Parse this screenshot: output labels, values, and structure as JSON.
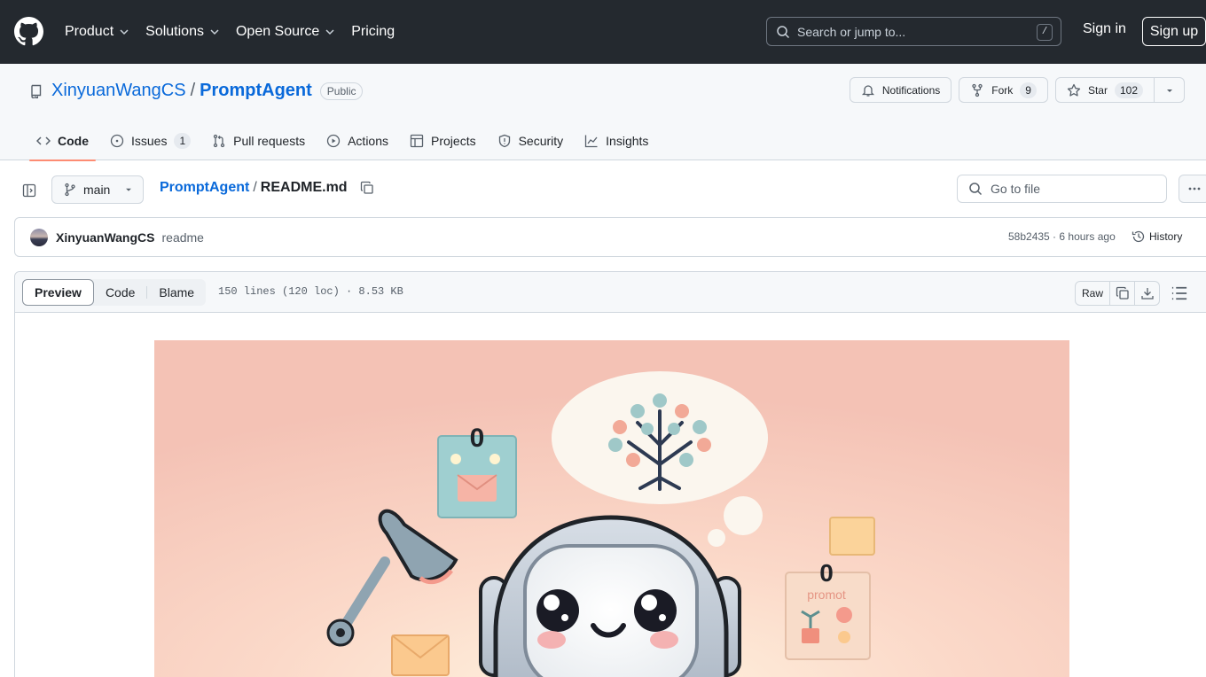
{
  "header": {
    "nav": [
      {
        "label": "Product",
        "dropdown": true
      },
      {
        "label": "Solutions",
        "dropdown": true
      },
      {
        "label": "Open Source",
        "dropdown": true
      },
      {
        "label": "Pricing",
        "dropdown": false
      }
    ],
    "search_placeholder": "Search or jump to...",
    "search_shortcut": "/",
    "sign_in": "Sign in",
    "sign_up": "Sign up"
  },
  "repo": {
    "owner": "XinyuanWangCS",
    "separator": "/",
    "name": "PromptAgent",
    "visibility": "Public",
    "notifications_label": "Notifications",
    "fork_label": "Fork",
    "fork_count": "9",
    "star_label": "Star",
    "star_count": "102"
  },
  "tabs": [
    {
      "label": "Code",
      "icon": "code-icon",
      "active": true
    },
    {
      "label": "Issues",
      "icon": "issue-icon",
      "count": "1"
    },
    {
      "label": "Pull requests",
      "icon": "pull-request-icon"
    },
    {
      "label": "Actions",
      "icon": "play-icon"
    },
    {
      "label": "Projects",
      "icon": "table-icon"
    },
    {
      "label": "Security",
      "icon": "shield-icon"
    },
    {
      "label": "Insights",
      "icon": "graph-icon"
    }
  ],
  "file_nav": {
    "branch": "main",
    "breadcrumb_repo": "PromptAgent",
    "breadcrumb_sep": "/",
    "file_name": "README.md",
    "goto_placeholder": "Go to file"
  },
  "commit": {
    "author": "XinyuanWangCS",
    "message": "readme",
    "meta": "58b2435 · 6 hours ago",
    "history_label": "History"
  },
  "viewer": {
    "modes": [
      "Preview",
      "Code",
      "Blame"
    ],
    "active_mode": "Preview",
    "file_info": "150 lines (120 loc) · 8.53 KB",
    "raw_label": "Raw"
  },
  "readme_image": {
    "calendar_left_digit": "0",
    "calendar_right_digit": "0",
    "note_text": "promot"
  },
  "colors": {
    "header_bg": "#24292f",
    "link": "#0969da",
    "active_tab_underline": "#fd8c73",
    "image_bg": "#f4c4b8"
  }
}
